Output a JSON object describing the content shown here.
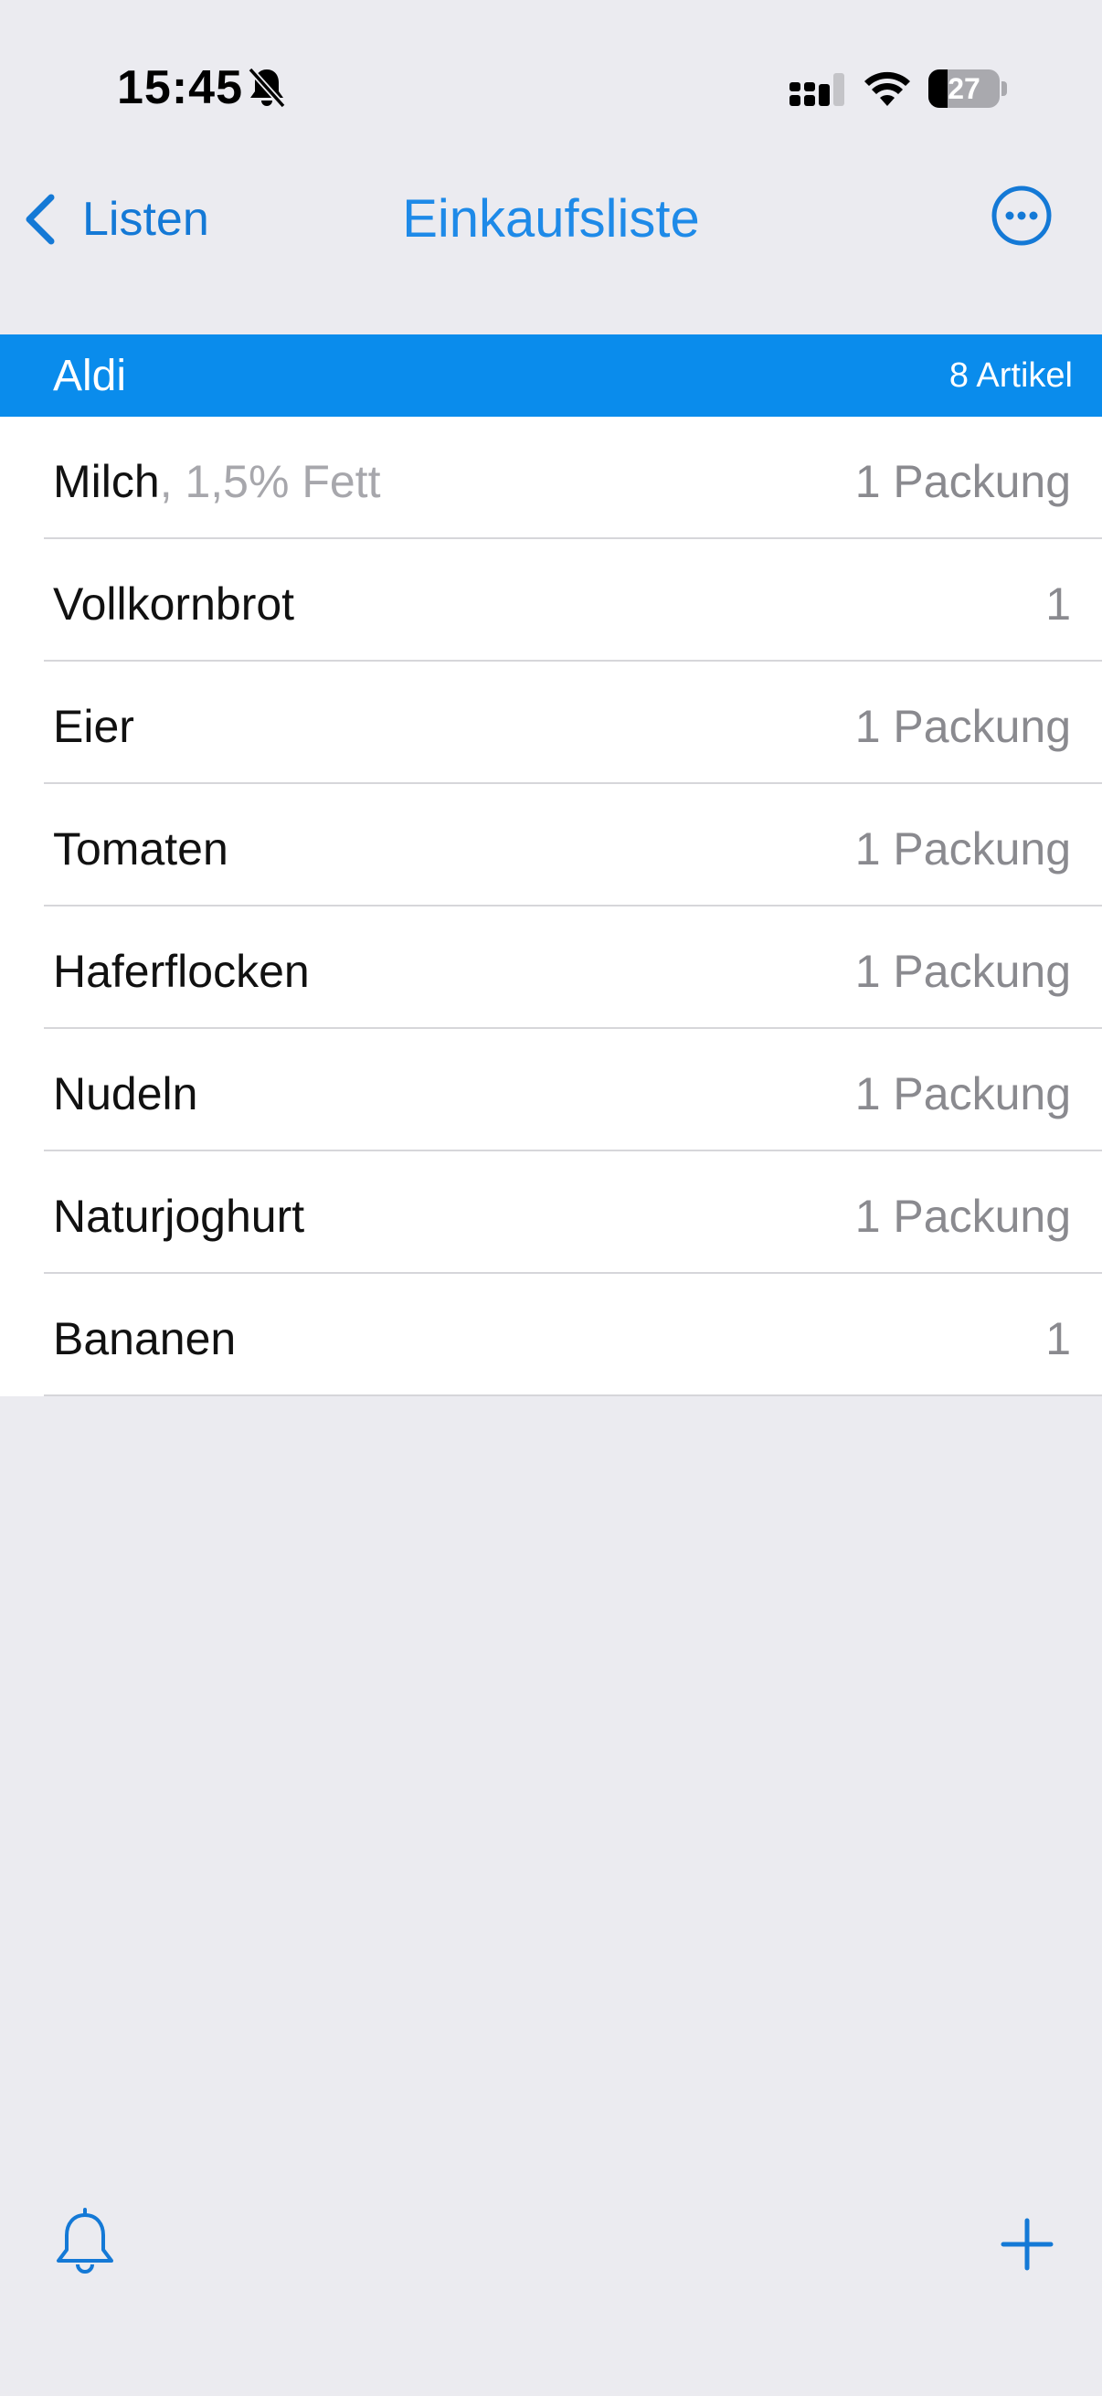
{
  "status_bar": {
    "time": "15:45",
    "battery_level": "27",
    "icons": [
      "bell-slash-icon",
      "cellular-signal-icon",
      "wifi-icon",
      "battery-icon"
    ]
  },
  "nav": {
    "back_label": "Listen",
    "title": "Einkaufsliste",
    "more_icon": "ellipsis-circle-icon"
  },
  "colors": {
    "accent": "#1479d6",
    "section_header_bg": "#0a8cec",
    "background": "#ebebf0"
  },
  "section": {
    "title": "Aldi",
    "count": "8 Artikel"
  },
  "items": [
    {
      "name": "Milch",
      "note": ", 1,5% Fett",
      "qty": "1 Packung"
    },
    {
      "name": "Vollkornbrot",
      "note": "",
      "qty": "1"
    },
    {
      "name": "Eier",
      "note": "",
      "qty": "1 Packung"
    },
    {
      "name": "Tomaten",
      "note": "",
      "qty": "1 Packung"
    },
    {
      "name": "Haferflocken",
      "note": "",
      "qty": "1 Packung"
    },
    {
      "name": "Nudeln",
      "note": "",
      "qty": "1 Packung"
    },
    {
      "name": "Naturjoghurt",
      "note": "",
      "qty": "1 Packung"
    },
    {
      "name": "Bananen",
      "note": "",
      "qty": "1"
    }
  ],
  "toolbar": {
    "left_icon": "bell-icon",
    "right_icon": "plus-icon"
  }
}
